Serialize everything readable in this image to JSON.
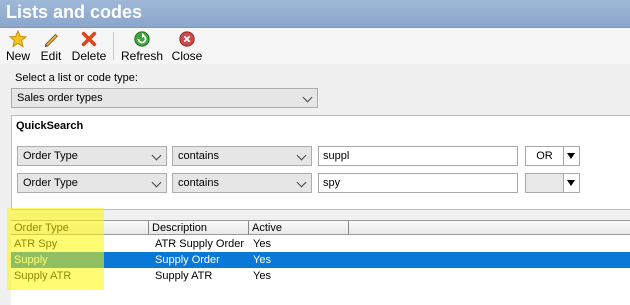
{
  "window": {
    "title": "Lists and codes"
  },
  "toolbar": {
    "new_label": "New",
    "edit_label": "Edit",
    "delete_label": "Delete",
    "refresh_label": "Refresh",
    "close_label": "Close"
  },
  "selector": {
    "label": "Select a list or code type:",
    "value": "Sales order types"
  },
  "quicksearch": {
    "title": "QuickSearch",
    "rows": [
      {
        "field": "Order Type",
        "operator": "contains",
        "value": "suppl",
        "join": "OR"
      },
      {
        "field": "Order Type",
        "operator": "contains",
        "value": "spy",
        "join": ""
      }
    ]
  },
  "grid": {
    "columns": [
      "Order Type",
      "Description",
      "Active"
    ],
    "rows": [
      {
        "order_type": "ATR Spy",
        "description": "ATR Supply Order",
        "active": "Yes",
        "selected": false
      },
      {
        "order_type": "Supply",
        "description": "Supply Order",
        "active": "Yes",
        "selected": true
      },
      {
        "order_type": "Supply ATR",
        "description": "Supply ATR",
        "active": "Yes",
        "selected": false
      }
    ]
  },
  "colors": {
    "titlebar": "#8aa6cb",
    "selection": "#0a78d7",
    "highlight": "#fffa00"
  },
  "icons": {
    "new": "star-icon",
    "edit": "pencil-icon",
    "delete": "x-icon",
    "refresh": "refresh-icon",
    "close": "close-circle-icon"
  }
}
